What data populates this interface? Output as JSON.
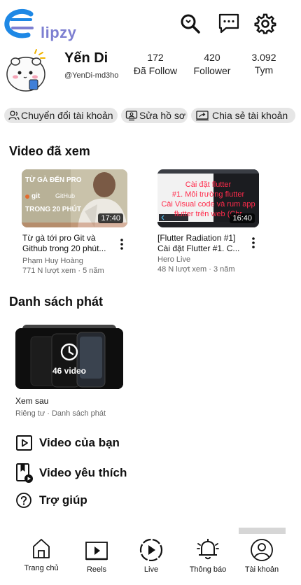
{
  "app": {
    "name": "Clipzy",
    "logo_text": "lipzy"
  },
  "profile": {
    "name": "Yến Di",
    "handle": "@YenDi-md3ho",
    "stats": [
      {
        "value": "172",
        "label": "Đã Follow"
      },
      {
        "value": "420",
        "label": "Follower"
      },
      {
        "value": "3.092",
        "label": "Tym"
      }
    ]
  },
  "chips": [
    {
      "label": "Chuyển đổi tài khoản",
      "icon": "switch-account-icon"
    },
    {
      "label": "Sửa hồ sơ",
      "icon": "edit-profile-icon"
    },
    {
      "label": "Chia sẻ tài khoản",
      "icon": "share-account-icon"
    }
  ],
  "history": {
    "title": "Video đã xem",
    "videos": [
      {
        "title": "Từ gà tới pro Git và Github trong 20 phút...",
        "channel": "Phạm Huy Hoàng",
        "meta": "771 N lượt xem · 5 năm",
        "duration": "17:40",
        "thumb_text": [
          "TỪ GÀ ĐẾN PRO",
          "git",
          "GitHub",
          "TRONG 20 PHÚT"
        ]
      },
      {
        "title": "[Flutter Radiation #1] Cài đặt Flutter #1. C...",
        "channel": "Hero Live",
        "meta": "48 N lượt xem · 3 năm",
        "duration": "16:40",
        "thumb_text": [
          "Cài đặt flutter",
          "#1. Môi trường flutter",
          "Cài Visual code và rum app",
          "flutter trên web (Chr"
        ]
      }
    ]
  },
  "playlists": {
    "title": "Danh sách phát",
    "items": [
      {
        "name": "Xem sau",
        "meta": "Riêng tư · Danh sách phát",
        "count": "46 video"
      }
    ]
  },
  "menu": [
    {
      "label": "Video của bạn",
      "icon": "play-square-icon"
    },
    {
      "label": "Video yêu thích",
      "icon": "bookmark-video-icon"
    },
    {
      "label": "Trợ giúp",
      "icon": "help-icon"
    }
  ],
  "nav": [
    {
      "label": "Trang chủ",
      "icon": "home-icon"
    },
    {
      "label": "Reels",
      "icon": "reels-icon"
    },
    {
      "label": "Live",
      "icon": "live-icon"
    },
    {
      "label": "Thông báo",
      "icon": "bell-icon"
    },
    {
      "label": "Tài khoản",
      "icon": "account-icon"
    }
  ],
  "colors": {
    "logo": "#7d7fd1",
    "logo_blue": "#1e88e5",
    "chip_bg": "#e6e6e6",
    "meta": "#666666"
  }
}
